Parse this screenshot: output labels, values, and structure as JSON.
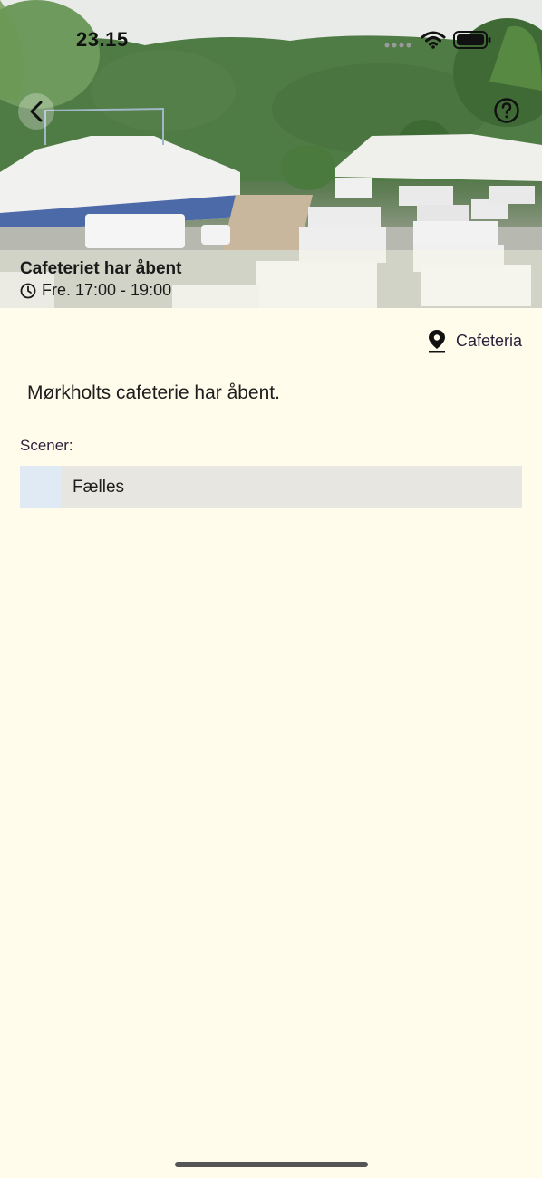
{
  "status_bar": {
    "time": "23.15"
  },
  "hero": {
    "image_icon": "festival-campsite-photo",
    "back_icon": "chevron-left-icon",
    "help_icon": "question-circle-icon",
    "title": "Cafeteriet har åbent",
    "time_icon": "clock-icon",
    "time": "Fre. 17:00 - 19:00"
  },
  "location": {
    "icon": "map-pin-icon",
    "label": "Cafeteria"
  },
  "description": "Mørkholts cafeterie har åbent.",
  "scenes": {
    "label": "Scener:",
    "items": [
      {
        "name": "Fælles",
        "color": "#DFEAF4"
      }
    ]
  },
  "colors": {
    "background": "#FFFCEC",
    "row_background": "#E8E6E0"
  }
}
